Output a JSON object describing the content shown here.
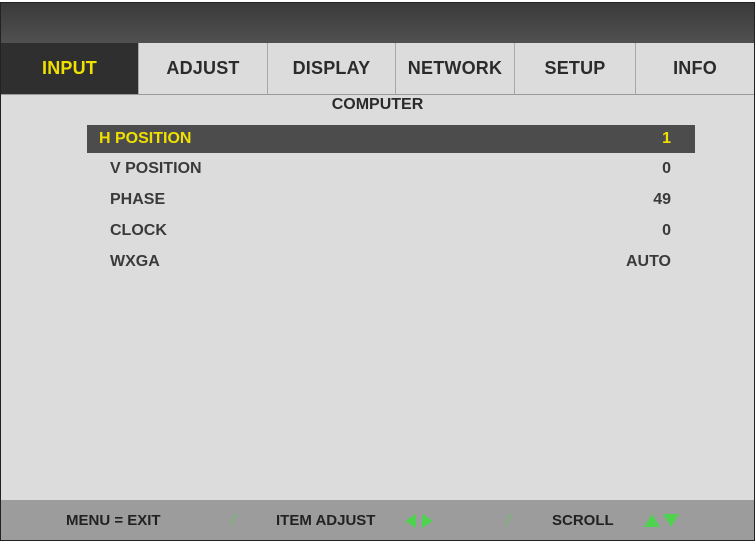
{
  "tabs": [
    {
      "label": "INPUT",
      "active": true
    },
    {
      "label": "ADJUST",
      "active": false
    },
    {
      "label": "DISPLAY",
      "active": false
    },
    {
      "label": "NETWORK",
      "active": false
    },
    {
      "label": "SETUP",
      "active": false
    },
    {
      "label": "INFO",
      "active": false
    }
  ],
  "submenu": {
    "title": "COMPUTER"
  },
  "items": [
    {
      "label": "H POSITION",
      "value": "1",
      "selected": true
    },
    {
      "label": "V POSITION",
      "value": "0",
      "selected": false
    },
    {
      "label": "PHASE",
      "value": "49",
      "selected": false
    },
    {
      "label": "CLOCK",
      "value": "0",
      "selected": false
    },
    {
      "label": "WXGA",
      "value": "AUTO",
      "selected": false
    }
  ],
  "footer": {
    "menu_exit": "MENU = EXIT",
    "item_adjust": "ITEM ADJUST",
    "scroll": "SCROLL",
    "separator": "/"
  },
  "colors": {
    "highlight_text": "#f0e000",
    "selected_bg": "#4c4c4c",
    "arrow_green": "#4fd24f",
    "panel_bg": "#dcdcdc",
    "footer_bg": "#9c9c9c"
  }
}
